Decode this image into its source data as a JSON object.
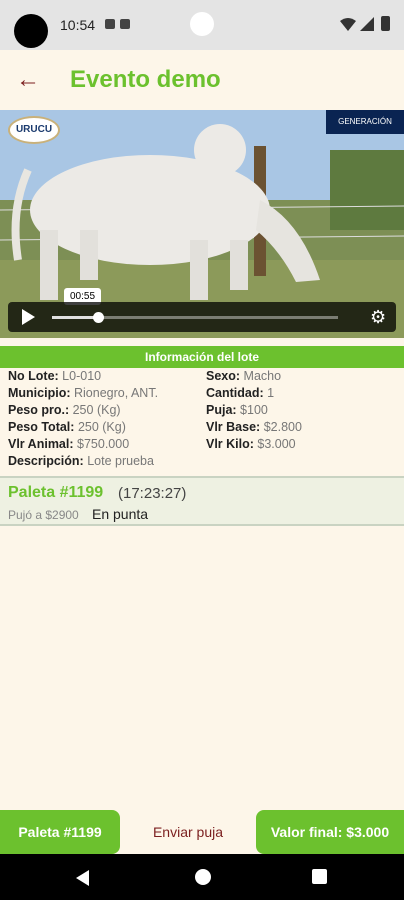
{
  "status_bar": {
    "time": "10:54"
  },
  "header": {
    "title": "Evento demo"
  },
  "video": {
    "logo_left": "URUCU",
    "logo_right": "GENERACIÓN",
    "time_tooltip": "00:55",
    "progress": 0.16
  },
  "lot": {
    "header": "Información del lote",
    "left": [
      {
        "label": "No Lote:",
        "value": "L0-010"
      },
      {
        "label": "Municipio:",
        "value": "Rionegro, ANT."
      },
      {
        "label": "Peso pro.:",
        "value": "250 (Kg)"
      },
      {
        "label": "Peso Total:",
        "value": "250 (Kg)"
      },
      {
        "label": "Vlr Animal:",
        "value": "$750.000"
      },
      {
        "label": "Descripción:",
        "value": "Lote prueba"
      }
    ],
    "right": [
      {
        "label": "Sexo:",
        "value": "Macho"
      },
      {
        "label": "Cantidad:",
        "value": "1"
      },
      {
        "label": "Puja:",
        "value": "$100"
      },
      {
        "label": "Vlr Base:",
        "value": "$2.800"
      },
      {
        "label": "Vlr Kilo:",
        "value": "$3.000"
      }
    ]
  },
  "bid": {
    "paddle": "Paleta #1199",
    "time": "(17:23:27)",
    "amount": "Pujó a $2900",
    "state": "En punta"
  },
  "bottom": {
    "paddle_label": "Paleta #1199",
    "send_label": "Enviar puja",
    "final_label": "Valor final: $3.000"
  },
  "colors": {
    "accent": "#6cc12e",
    "back": "#7b1f1f",
    "background": "#fdf6e9"
  }
}
